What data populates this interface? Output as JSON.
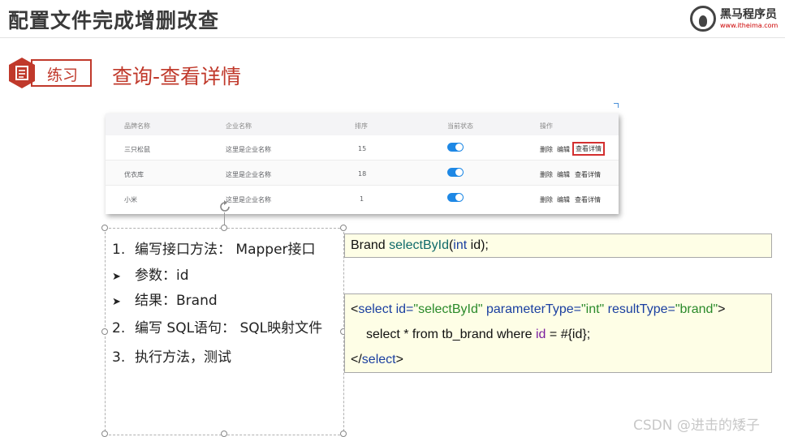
{
  "header": {
    "title": "配置文件完成增删改查",
    "logo_brand": "黑马程序员",
    "logo_url": "www.itheima.com"
  },
  "exercise": {
    "label": "练习",
    "subtitle": "查询-查看详情"
  },
  "table": {
    "headers": [
      "品牌名称",
      "企业名称",
      "排序",
      "当前状态",
      "操作"
    ],
    "rows": [
      {
        "brand": "三只松鼠",
        "company": "这里是企业名称",
        "order": "15",
        "status_on": true
      },
      {
        "brand": "优衣库",
        "company": "这里是企业名称",
        "order": "18",
        "status_on": true
      },
      {
        "brand": "小米",
        "company": "这里是企业名称",
        "order": "1",
        "status_on": true
      }
    ],
    "actions": {
      "delete": "删除",
      "edit": "编辑",
      "details": "查看详情"
    },
    "highlight_color": "#d32f2f",
    "switch_color": "#1e88e5"
  },
  "steps": {
    "s1_num": "1.",
    "s1_text": "编写接口方法： Mapper接口",
    "b1_text": "参数：id",
    "b2_text": "结果：Brand",
    "s2_num": "2.",
    "s2_text": "编写 SQL语句： SQL映射文件",
    "s3_num": "3.",
    "s3_text": "执行方法，测试"
  },
  "code1": {
    "type": "Brand",
    "method": "selectById",
    "open_paren": "(",
    "param_type": "int",
    "param_rest": " id);"
  },
  "code2": {
    "lt": "<",
    "tag": "select",
    "a1_name": " id=",
    "a1_val": "\"selectById\"",
    "a2_name": " parameterType=",
    "a2_val": "\"int\"",
    "a3_name": " resultType=",
    "a3_val": "\"brand\"",
    "gt": ">",
    "sql_a": "select * from tb_brand where ",
    "sql_var": "id",
    "sql_b": " = #{id};",
    "close_lt": "</",
    "close_tag": "select",
    "close_gt": ">"
  },
  "watermark": "CSDN @进击的矮子",
  "colors": {
    "accent": "#c0392b",
    "code_bg": "#fefee6"
  }
}
